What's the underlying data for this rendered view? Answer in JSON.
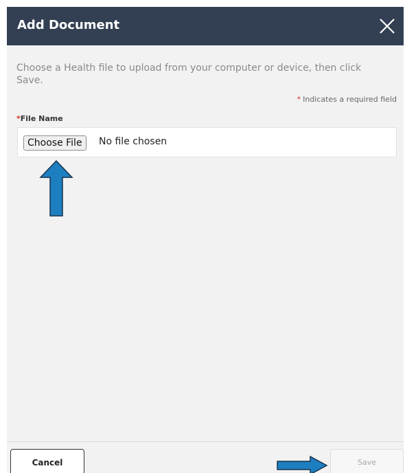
{
  "dialog": {
    "title": "Add Document",
    "close_icon": "close-x-icon",
    "header_color": "#333f52"
  },
  "instructions": "Choose a Health file to upload from your computer or device, then click Save.",
  "required_note": {
    "star": "*",
    "text": "Indicates a required field",
    "star_color": "#d0342c"
  },
  "file_field": {
    "label_star": "*",
    "label": "File Name",
    "button_label": "Choose File",
    "status": "No file chosen"
  },
  "annotations": {
    "up_arrow_icon": "up-arrow-icon",
    "right_arrow_icon": "right-arrow-icon",
    "arrow_color": "#1e7fc0"
  },
  "footer": {
    "cancel_label": "Cancel",
    "save_label": "Save"
  }
}
